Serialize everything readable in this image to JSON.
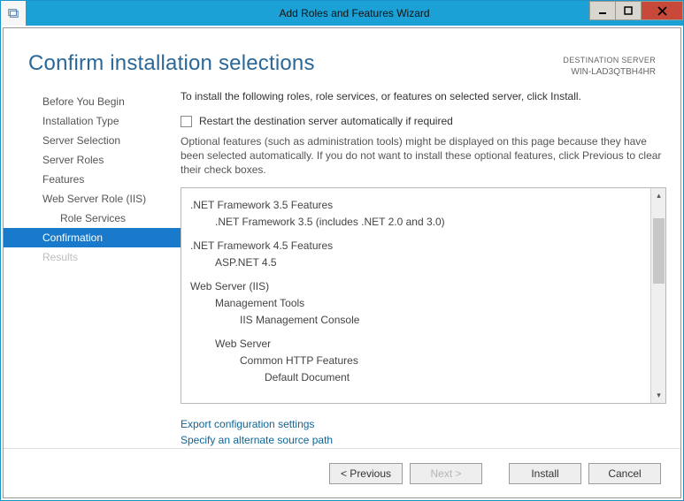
{
  "titlebar": {
    "title": "Add Roles and Features Wizard"
  },
  "destination": {
    "label": "DESTINATION SERVER",
    "name": "WIN-LAD3QTBH4HR"
  },
  "page": {
    "title": "Confirm installation selections"
  },
  "sidebar": {
    "items": [
      {
        "label": "Before You Begin",
        "sub": false,
        "active": false,
        "disabled": false
      },
      {
        "label": "Installation Type",
        "sub": false,
        "active": false,
        "disabled": false
      },
      {
        "label": "Server Selection",
        "sub": false,
        "active": false,
        "disabled": false
      },
      {
        "label": "Server Roles",
        "sub": false,
        "active": false,
        "disabled": false
      },
      {
        "label": "Features",
        "sub": false,
        "active": false,
        "disabled": false
      },
      {
        "label": "Web Server Role (IIS)",
        "sub": false,
        "active": false,
        "disabled": false
      },
      {
        "label": "Role Services",
        "sub": true,
        "active": false,
        "disabled": false
      },
      {
        "label": "Confirmation",
        "sub": false,
        "active": true,
        "disabled": false
      },
      {
        "label": "Results",
        "sub": false,
        "active": false,
        "disabled": true
      }
    ]
  },
  "main": {
    "intro": "To install the following roles, role services, or features on selected server, click Install.",
    "restart_label": "Restart the destination server automatically if required",
    "optional_note": "Optional features (such as administration tools) might be displayed on this page because they have been selected automatically. If you do not want to install these optional features, click Previous to clear their check boxes."
  },
  "features": [
    {
      "level": 0,
      "label": ".NET Framework 3.5 Features"
    },
    {
      "level": 1,
      "label": ".NET Framework 3.5 (includes .NET 2.0 and 3.0)"
    },
    {
      "gap": true
    },
    {
      "level": 0,
      "label": ".NET Framework 4.5 Features"
    },
    {
      "level": 1,
      "label": "ASP.NET 4.5"
    },
    {
      "gap": true
    },
    {
      "level": 0,
      "label": "Web Server (IIS)"
    },
    {
      "level": 1,
      "label": "Management Tools"
    },
    {
      "level": 2,
      "label": "IIS Management Console"
    },
    {
      "gap": true
    },
    {
      "level": 1,
      "label": "Web Server"
    },
    {
      "level": 2,
      "label": "Common HTTP Features"
    },
    {
      "level": 3,
      "label": "Default Document"
    }
  ],
  "links": {
    "export": "Export configuration settings",
    "source": "Specify an alternate source path"
  },
  "footer": {
    "previous": "< Previous",
    "next": "Next >",
    "install": "Install",
    "cancel": "Cancel"
  }
}
